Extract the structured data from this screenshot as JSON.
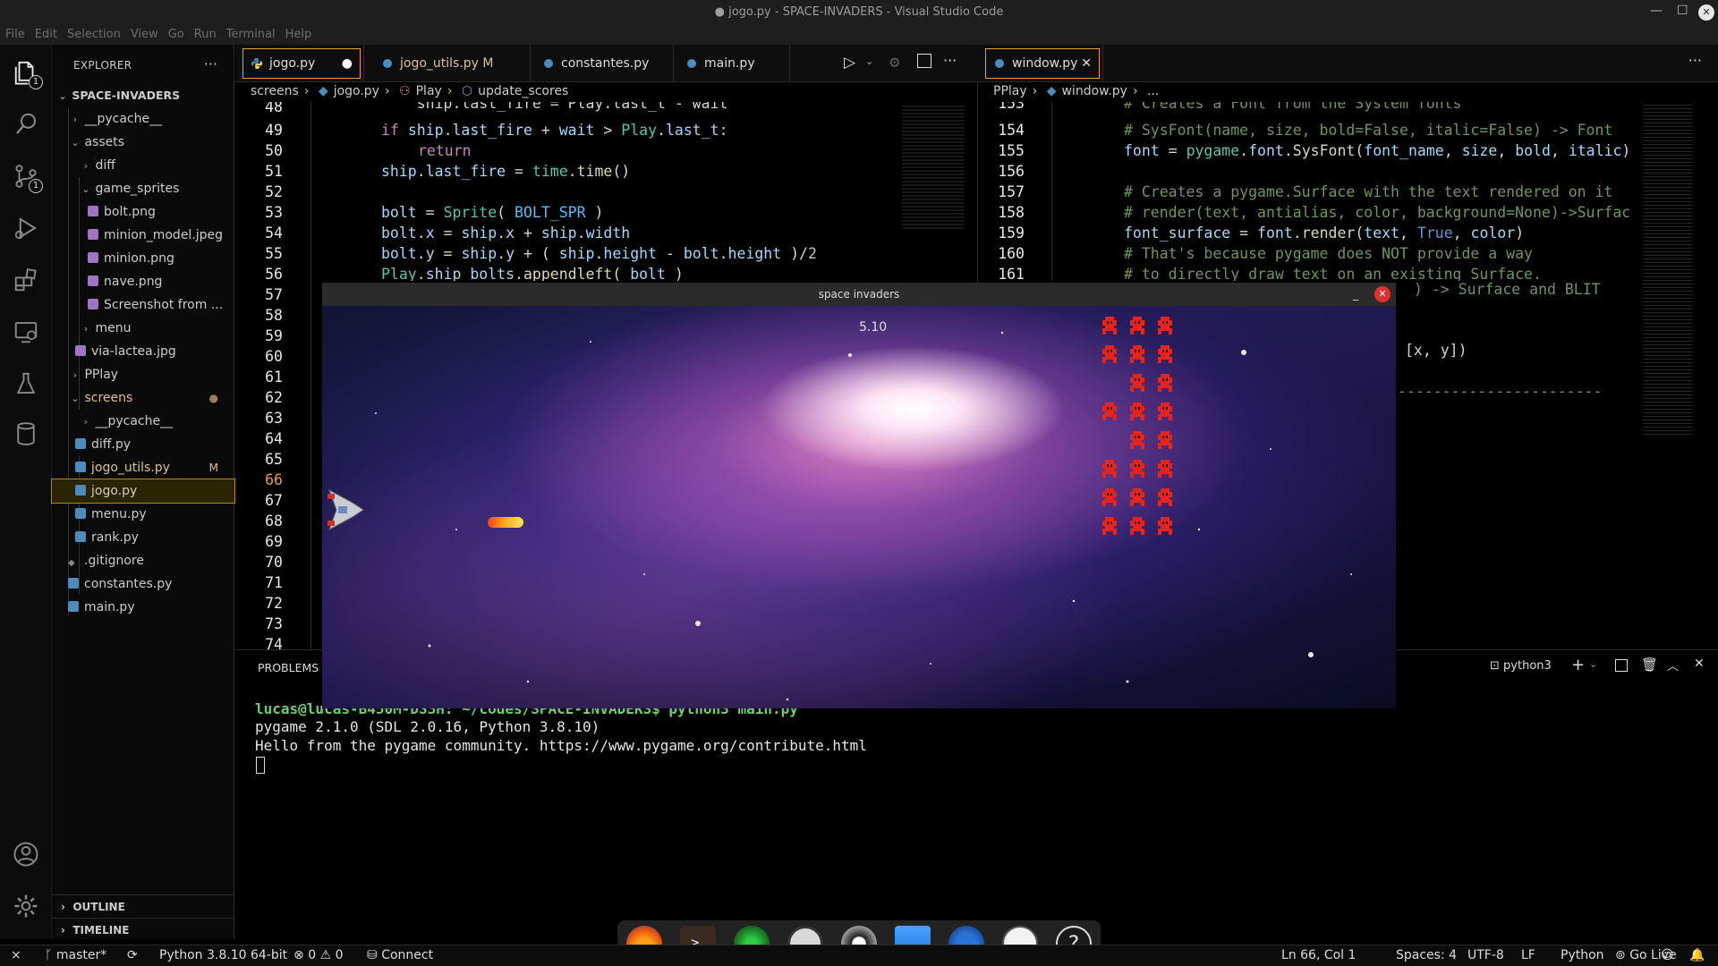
{
  "window": {
    "title": "● jogo.py - SPACE-INVADERS - Visual Studio Code",
    "controls": [
      "—",
      "☐",
      "✕"
    ]
  },
  "menu": [
    "File",
    "Edit",
    "Selection",
    "View",
    "Go",
    "Run",
    "Terminal",
    "Help"
  ],
  "activity_bar": {
    "explorer_badge": "1",
    "scm_badge": "1"
  },
  "explorer": {
    "header": "EXPLORER",
    "more": "···",
    "root": "SPACE-INVADERS",
    "items": [
      {
        "label": "__pycache__"
      },
      {
        "label": "assets"
      },
      {
        "label": "diff"
      },
      {
        "label": "game_sprites"
      },
      {
        "label": "bolt.png"
      },
      {
        "label": "minion_model.jpeg"
      },
      {
        "label": "minion.png"
      },
      {
        "label": "nave.png"
      },
      {
        "label": "Screenshot from ..."
      },
      {
        "label": "menu"
      },
      {
        "label": "via-lactea.jpg"
      },
      {
        "label": "PPlay"
      },
      {
        "label": "screens"
      },
      {
        "label": "__pycache__"
      },
      {
        "label": "diff.py"
      },
      {
        "label": "jogo_utils.py",
        "decoration": "M"
      },
      {
        "label": "jogo.py"
      },
      {
        "label": "menu.py"
      },
      {
        "label": "rank.py"
      },
      {
        "label": ".gitignore"
      },
      {
        "label": "constantes.py"
      },
      {
        "label": "main.py"
      }
    ],
    "outline": "OUTLINE",
    "timeline": "TIMELINE"
  },
  "left_editor": {
    "tabs": [
      "jogo.py",
      "jogo_utils.py M",
      "constantes.py",
      "main.py"
    ],
    "active_dirty_marker": "●",
    "breadcrumb": [
      "screens",
      "jogo.py",
      "Play",
      "update_scores"
    ],
    "line_numbers": [
      "48",
      "49",
      "50",
      "51",
      "52",
      "53",
      "54",
      "55",
      "56",
      "57",
      "58",
      "59",
      "60",
      "61",
      "62",
      "63",
      "64",
      "65",
      "66",
      "67",
      "68",
      "69",
      "70",
      "71",
      "72",
      "73",
      "74"
    ],
    "visible_code": [
      "    ship.last_fire = Play.last_t - wait",
      "if ship.last_fire + wait > Play.last_t:",
      "    return",
      "ship.last_fire = time.time()",
      "",
      "bolt = Sprite( BOLT_SPR )",
      "bolt.x = ship.x + ship.width",
      "bolt.y = ship.y + ( ship.height - bolt.height )/2",
      "Play.ship_bolts.appendleft( bolt )"
    ]
  },
  "right_editor": {
    "tab": "window.py",
    "breadcrumb": [
      "PPlay",
      "window.py",
      "..."
    ],
    "line_numbers": [
      "153",
      "154",
      "155",
      "156",
      "157",
      "158",
      "159",
      "160",
      "161"
    ],
    "visible_code": [
      "# Creates a Font from the System fonts",
      "# SysFont(name, size, bold=False, italic=False) -> Font",
      "font = pygame.font.SysFont(font_name, size, bold, italic)",
      "",
      "# Creates a pygame.Surface with the text rendered on it",
      "# render(text, antialias, color, background=None)->Surfac",
      "font_surface = font.render(text, True, color)",
      "# That's because pygame does NOT provide a way",
      "# to directly draw text on an existing Surface."
    ],
    "partial_lines": [
      ") -> Surface and BLIT",
      "[x, y])",
      "------------------------"
    ]
  },
  "panel": {
    "tab": "PROBLEMS",
    "terminal_name": "python3",
    "terminal_lines": [
      "lucas@lucas-B450M-DS3H: ~/codes/SPACE-INVADERS$ python3 main.py",
      "pygame 2.1.0 (SDL 2.0.16, Python 3.8.10)",
      "Hello from the pygame community. https://www.pygame.org/contribute.html"
    ]
  },
  "game": {
    "title": "space invaders",
    "score": "5.10"
  },
  "status": {
    "branch": "master*",
    "interpreter": "Python 3.8.10 64-bit",
    "errors": "0",
    "warnings": "0",
    "connect": "Connect",
    "position": "Ln 66, Col 1",
    "spaces": "Spaces: 4",
    "encoding": "UTF-8",
    "eol": "LF",
    "language": "Python",
    "golive": "Go Live"
  },
  "colors": {
    "modified": "#e2c08d",
    "active_tab_border": "#f0a030",
    "invader_red": "#e8231a",
    "python_icon": "#4b8bbe"
  }
}
